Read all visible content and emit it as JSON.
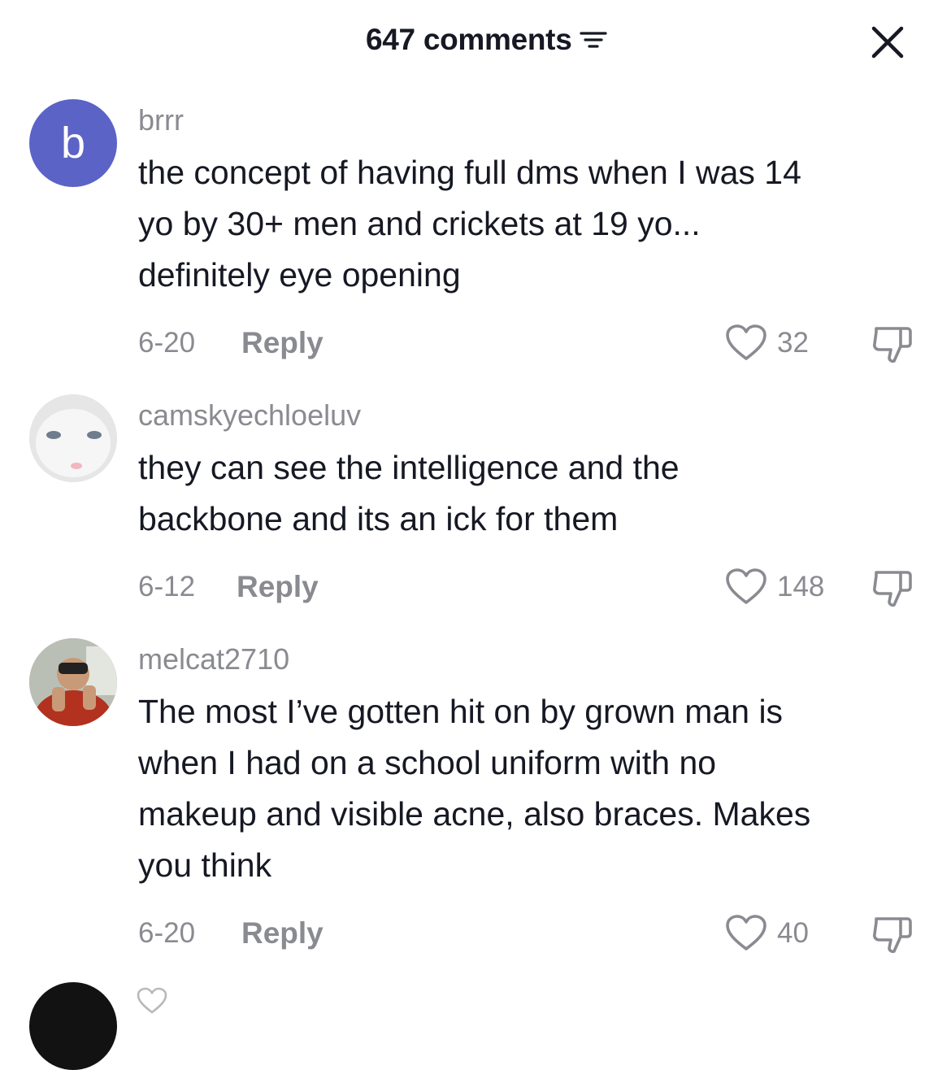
{
  "header": {
    "comment_count": "647 comments",
    "filter_icon": "filter-lines-icon",
    "close_icon": "close-icon"
  },
  "comments": [
    {
      "avatar_letter": "b",
      "avatar_color": "#5b63c6",
      "username": "brrr",
      "lines": [
        "the concept of having full dms when I was 14",
        "yo by 30+ men and crickets at 19 yo...",
        "definitely eye opening"
      ],
      "date": "6-20",
      "reply_label": "Reply",
      "likes": "32"
    },
    {
      "avatar_desc": "white-cat-photo",
      "username": "camskyechloeluv",
      "lines": [
        "they can see the intelligence and the",
        "backbone and its an ick for them"
      ],
      "date": "6-12",
      "reply_label": "Reply",
      "likes": "148"
    },
    {
      "avatar_desc": "person-with-binoculars-photo",
      "username": "melcat2710",
      "lines": [
        "The most I’ve gotten hit on by grown man is",
        "when I had on a school uniform with no",
        "makeup and visible acne, also braces. Makes",
        "you think"
      ],
      "date": "6-20",
      "reply_label": "Reply",
      "likes": "40"
    }
  ],
  "colors": {
    "text_primary": "#161823",
    "text_secondary": "#8a8b91",
    "background": "#ffffff"
  }
}
